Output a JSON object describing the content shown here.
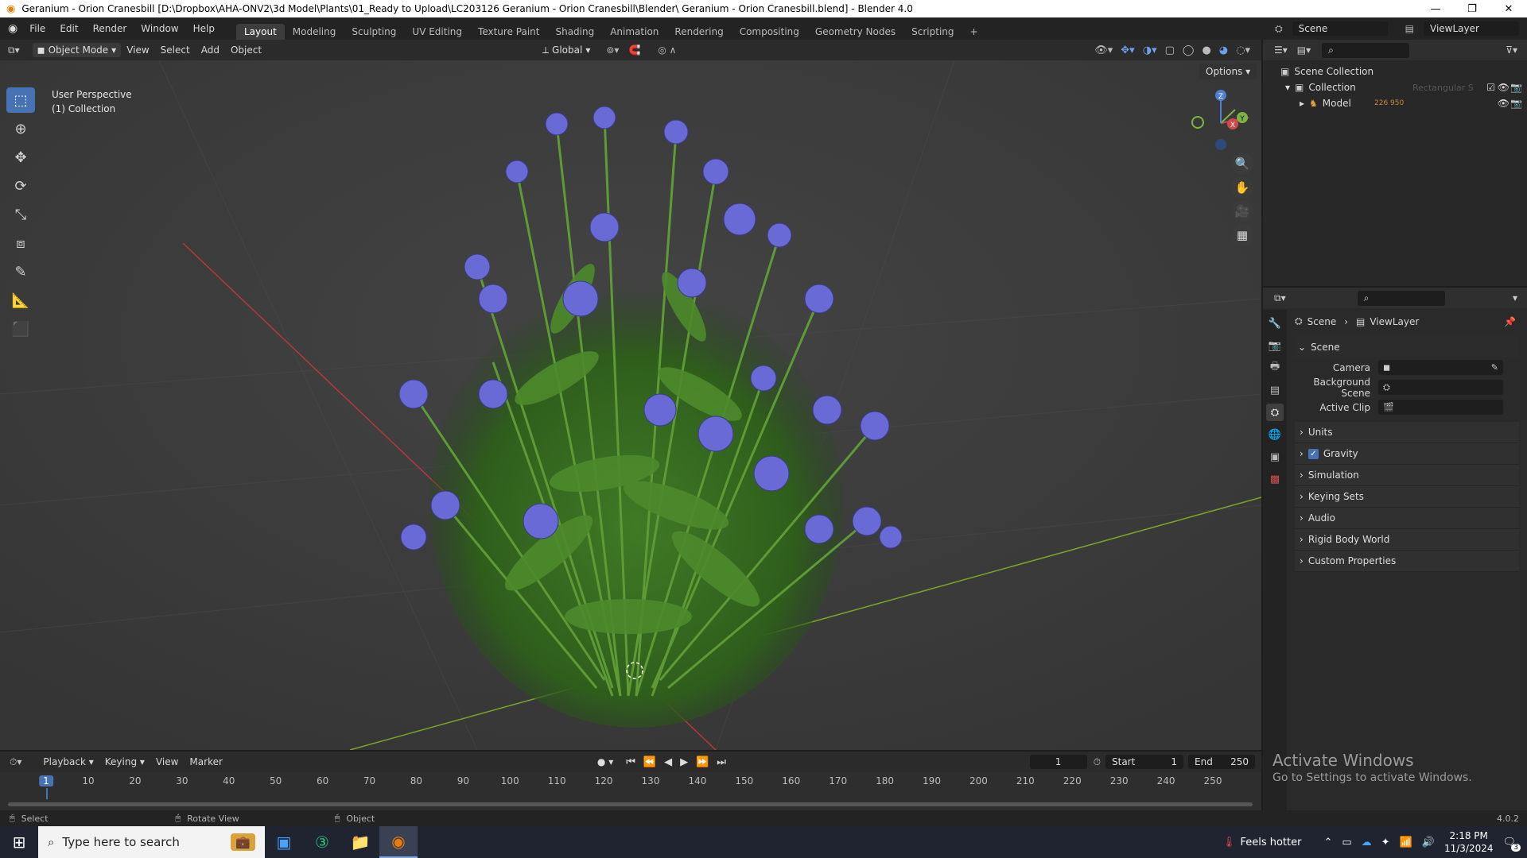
{
  "window": {
    "title": "Geranium - Orion Cranesbill [D:\\Dropbox\\AHA-ONV2\\3d Model\\Plants\\01_Ready to Upload\\LC203126 Geranium - Orion Cranesbill\\Blender\\ Geranium - Orion Cranesbill.blend] - Blender 4.0",
    "minimize": "—",
    "maximize": "❐",
    "close": "✕"
  },
  "menubar": {
    "items": [
      "File",
      "Edit",
      "Render",
      "Window",
      "Help"
    ]
  },
  "workspaces": {
    "tabs": [
      "Layout",
      "Modeling",
      "Sculpting",
      "UV Editing",
      "Texture Paint",
      "Shading",
      "Animation",
      "Rendering",
      "Compositing",
      "Geometry Nodes",
      "Scripting"
    ],
    "add": "+",
    "scene": "Scene",
    "view_layer": "ViewLayer"
  },
  "viewport_header": {
    "mode": "Object Mode",
    "menus": [
      "View",
      "Select",
      "Add",
      "Object"
    ],
    "transform_orientation": "Global",
    "options": "Options"
  },
  "viewport": {
    "perspective": "User Perspective",
    "collection": "(1) Collection",
    "gizmo_axes": [
      "X",
      "Y",
      "Z"
    ]
  },
  "outliner": {
    "scene_collection": "Scene Collection",
    "collection": "Collection",
    "model": "Model",
    "model_extra": "226 950",
    "ghost_label": "Rectangular S"
  },
  "properties": {
    "breadcrumb_scene": "Scene",
    "breadcrumb_viewlayer": "ViewLayer",
    "scene_panel": "Scene",
    "fields": {
      "camera": "Camera",
      "background_scene": "Background Scene",
      "active_clip": "Active Clip"
    },
    "panels": [
      "Units",
      "Gravity",
      "Simulation",
      "Keying Sets",
      "Audio",
      "Rigid Body World",
      "Custom Properties"
    ],
    "gravity_enabled": true
  },
  "timeline": {
    "menus": [
      "Playback",
      "Keying",
      "View",
      "Marker"
    ],
    "current_frame": "1",
    "start_label": "Start",
    "start": "1",
    "end_label": "End",
    "end": "250",
    "ticks": [
      "1",
      "10",
      "20",
      "30",
      "40",
      "50",
      "60",
      "70",
      "80",
      "90",
      "100",
      "110",
      "120",
      "130",
      "140",
      "150",
      "160",
      "170",
      "180",
      "190",
      "200",
      "210",
      "220",
      "230",
      "240",
      "250"
    ]
  },
  "watermark": {
    "title": "Activate Windows",
    "subtitle": "Go to Settings to activate Windows."
  },
  "statusbar": {
    "select": "Select",
    "rotate": "Rotate View",
    "object": "Object",
    "version": "4.0.2"
  },
  "taskbar": {
    "search_placeholder": "Type here to search",
    "weather": "Feels hotter",
    "time": "2:18 PM",
    "date": "11/3/2024",
    "notifications": "3"
  },
  "colors": {
    "accent": "#4772b3",
    "viewport_bg": "#3c3c3c",
    "flower": "#6a6ad6",
    "foliage": "#5e9a35",
    "x_axis": "#c0392b",
    "y_axis": "#7fae2c"
  }
}
